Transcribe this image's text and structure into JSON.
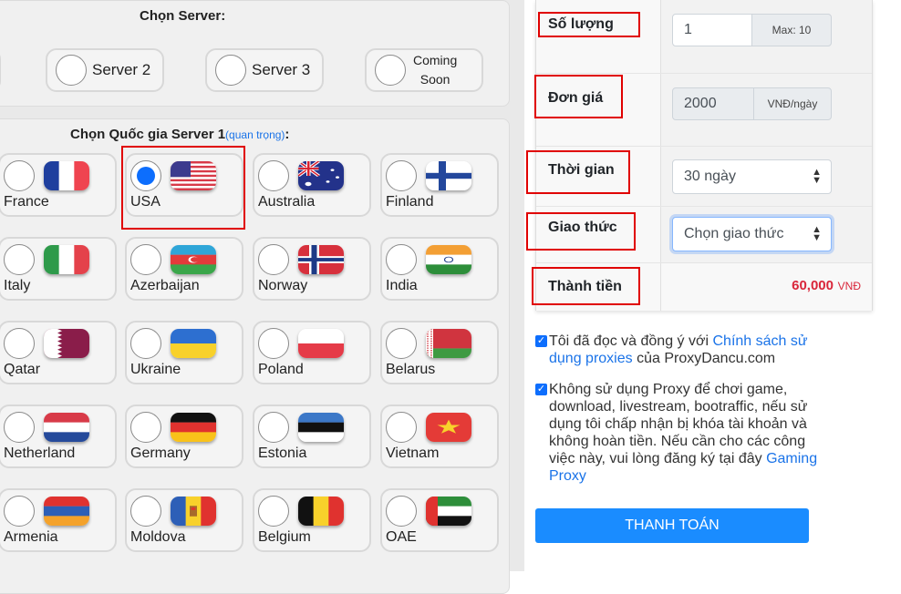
{
  "server_section": {
    "title": "Chọn Server:",
    "servers": [
      {
        "label": "Server 2"
      },
      {
        "label": "Server 3"
      },
      {
        "label_line1": "Coming",
        "label_line2": "Soon"
      }
    ]
  },
  "country_section": {
    "title": "Chọn Quốc gia Server 1",
    "title_note": "(quan trọng)",
    "title_colon": ":",
    "selected": "USA",
    "countries": [
      {
        "name": "France",
        "flag": "france-flag"
      },
      {
        "name": "USA",
        "flag": "usa-flag"
      },
      {
        "name": "Australia",
        "flag": "australia-flag"
      },
      {
        "name": "Finland",
        "flag": "finland-flag"
      },
      {
        "name": "Italy",
        "flag": "italy-flag"
      },
      {
        "name": "Azerbaijan",
        "flag": "azerbaijan-flag"
      },
      {
        "name": "Norway",
        "flag": "norway-flag"
      },
      {
        "name": "India",
        "flag": "india-flag"
      },
      {
        "name": "Qatar",
        "flag": "qatar-flag"
      },
      {
        "name": "Ukraine",
        "flag": "ukraine-flag"
      },
      {
        "name": "Poland",
        "flag": "poland-flag"
      },
      {
        "name": "Belarus",
        "flag": "belarus-flag"
      },
      {
        "name": "Netherland",
        "flag": "netherlands-flag"
      },
      {
        "name": "Germany",
        "flag": "germany-flag"
      },
      {
        "name": "Estonia",
        "flag": "estonia-flag"
      },
      {
        "name": "Vietnam",
        "flag": "vietnam-flag"
      },
      {
        "name": "Armenia",
        "flag": "armenia-flag"
      },
      {
        "name": "Moldova",
        "flag": "moldova-flag"
      },
      {
        "name": "Belgium",
        "flag": "belgium-flag"
      },
      {
        "name": "OAE",
        "flag": "uae-flag"
      }
    ]
  },
  "order": {
    "quantity_label": "Số lượng",
    "quantity_value": "1",
    "quantity_max": "Max: 10",
    "unit_price_label": "Đơn giá",
    "unit_price_value": "2000",
    "unit_price_unit": "VNĐ/ngày",
    "duration_label": "Thời gian",
    "duration_value": "30 ngày",
    "protocol_label": "Giao thức",
    "protocol_placeholder": "Chọn giao thức",
    "total_label": "Thành tiền",
    "total_value": "60,000",
    "total_unit": "VNĐ"
  },
  "agreements": {
    "policy_text_before": "Tôi đã đọc và đồng ý với ",
    "policy_link": "Chính sách sử dụng proxies",
    "policy_text_after": " của ProxyDancu.com",
    "gaming_text": "Không sử dụng Proxy để chơi game, download, livestream, bootraffic, nếu sử dụng tôi chấp nhận bị khóa tài khoản và không hoàn tiền. Nếu cần cho các công việc này, vui lòng đăng ký tại đây ",
    "gaming_link": "Gaming Proxy"
  },
  "pay_button": "THANH TOÁN",
  "colors": {
    "accent_blue": "#1a8cff",
    "highlight_red": "#e00000",
    "total_red": "#d9263a"
  }
}
